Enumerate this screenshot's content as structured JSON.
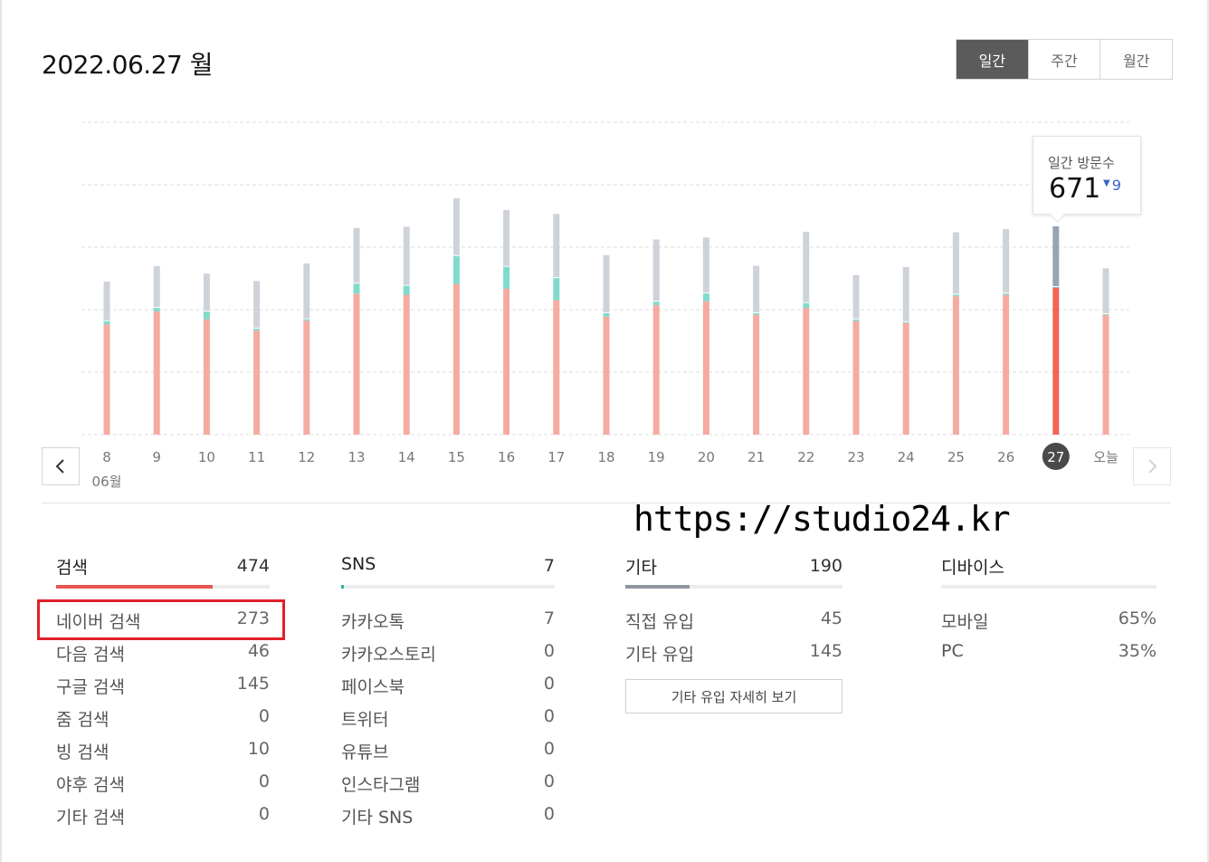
{
  "header": {
    "date_title": "2022.06.27 월",
    "periods": [
      {
        "label": "일간",
        "active": true
      },
      {
        "label": "주간",
        "active": false
      },
      {
        "label": "월간",
        "active": false
      }
    ]
  },
  "tooltip": {
    "label": "일간 방문수",
    "value": "671",
    "diff": "9",
    "diff_direction": "down",
    "diff_color": "#3b63c4"
  },
  "chart_data": {
    "type": "bar",
    "stacked": true,
    "month_label": "06월",
    "categories": [
      "8",
      "9",
      "10",
      "11",
      "12",
      "13",
      "14",
      "15",
      "16",
      "17",
      "18",
      "19",
      "20",
      "21",
      "22",
      "23",
      "24",
      "25",
      "26",
      "27",
      "오늘"
    ],
    "selected_index": 19,
    "selected_marker_color": "#4a4a4a",
    "series": [
      {
        "color": "#f5aba0",
        "selected_color": "#f36554",
        "values": [
          458,
          513,
          480,
          434,
          474,
          587,
          582,
          627,
          607,
          559,
          491,
          539,
          555,
          499,
          527,
          473,
          465,
          576,
          581,
          611,
          498
        ]
      },
      {
        "color": "#7fdbcc",
        "selected_color": "#5cc7b3",
        "values": [
          18,
          18,
          36,
          11,
          10,
          45,
          41,
          120,
          95,
          96,
          18,
          18,
          36,
          10,
          24,
          10,
          7,
          10,
          10,
          7,
          7
        ]
      },
      {
        "color": "#ced3d9",
        "selected_color": "#98a4b2",
        "values": [
          165,
          174,
          158,
          198,
          232,
          232,
          246,
          240,
          236,
          267,
          242,
          259,
          233,
          197,
          297,
          185,
          229,
          260,
          268,
          253,
          191
        ]
      }
    ],
    "ylim": [
      0,
      1300
    ],
    "grid": true
  },
  "watermark": "https://studio24.kr",
  "panels": [
    {
      "title": "검색",
      "total": "474",
      "bar_color": "#e8564f",
      "bar_fraction": 0.735,
      "rows": [
        {
          "label": "네이버 검색",
          "value": "273"
        },
        {
          "label": "다음 검색",
          "value": "46"
        },
        {
          "label": "구글 검색",
          "value": "145"
        },
        {
          "label": "줌 검색",
          "value": "0"
        },
        {
          "label": "빙 검색",
          "value": "10"
        },
        {
          "label": "야후 검색",
          "value": "0"
        },
        {
          "label": "기타 검색",
          "value": "0"
        }
      ]
    },
    {
      "title": "SNS",
      "total": "7",
      "bar_color": "#2bb5a2",
      "bar_fraction": 0.011,
      "rows": [
        {
          "label": "카카오톡",
          "value": "7"
        },
        {
          "label": "카카오스토리",
          "value": "0"
        },
        {
          "label": "페이스북",
          "value": "0"
        },
        {
          "label": "트위터",
          "value": "0"
        },
        {
          "label": "유튜브",
          "value": "0"
        },
        {
          "label": "인스타그램",
          "value": "0"
        },
        {
          "label": "기타 SNS",
          "value": "0"
        }
      ]
    },
    {
      "title": "기타",
      "total": "190",
      "bar_color": "#8f969e",
      "bar_fraction": 0.295,
      "rows": [
        {
          "label": "직접 유입",
          "value": "45"
        },
        {
          "label": "기타 유입",
          "value": "145"
        }
      ],
      "button_label": "기타 유입 자세히 보기"
    },
    {
      "title": "디바이스",
      "total": "",
      "bar_color": "#8f969e",
      "bar_fraction": 0,
      "rows": [
        {
          "label": "모바일",
          "value": "65%"
        },
        {
          "label": "PC",
          "value": "35%"
        }
      ]
    }
  ]
}
